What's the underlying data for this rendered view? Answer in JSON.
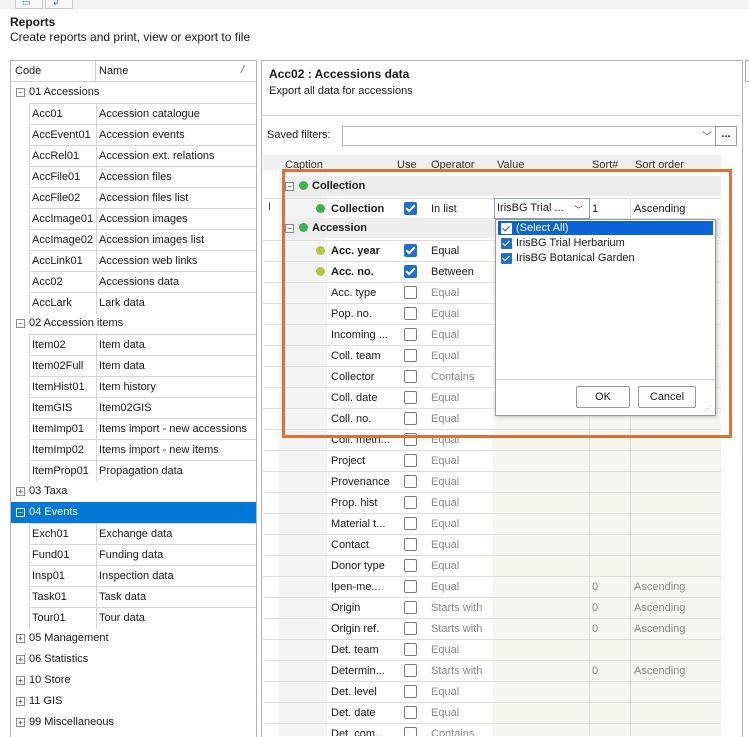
{
  "header": {
    "title": "Reports",
    "subtitle": "Create reports and print, view or export to file"
  },
  "left_panel": {
    "columns": {
      "code": "Code",
      "name": "Name",
      "sort_glyph": "/"
    },
    "groups": [
      {
        "label": "01 Accessions",
        "expanded": true,
        "selected": false,
        "items": [
          {
            "code": "Acc01",
            "name": "Accession catalogue"
          },
          {
            "code": "AccEvent01",
            "name": "Accession events"
          },
          {
            "code": "AccRel01",
            "name": "Accession ext. relations"
          },
          {
            "code": "AccFile01",
            "name": "Accession files"
          },
          {
            "code": "AccFile02",
            "name": "Accession files list"
          },
          {
            "code": "AccImage01",
            "name": "Accession images"
          },
          {
            "code": "AccImage02",
            "name": "Accession images list"
          },
          {
            "code": "AccLink01",
            "name": "Accession web links"
          },
          {
            "code": "Acc02",
            "name": "Accessions data"
          },
          {
            "code": "AccLark",
            "name": "Lark data"
          }
        ]
      },
      {
        "label": "02 Accession items",
        "expanded": true,
        "selected": false,
        "items": [
          {
            "code": "Item02",
            "name": "Item data"
          },
          {
            "code": "Item02Full",
            "name": "Item data"
          },
          {
            "code": "ItemHist01",
            "name": "Item history"
          },
          {
            "code": "ItemGIS",
            "name": "Item02GIS"
          },
          {
            "code": "ItemImp01",
            "name": "Items import - new accessions"
          },
          {
            "code": "ItemImp02",
            "name": "Items import - new items"
          },
          {
            "code": "ItemProp01",
            "name": "Propagation data"
          }
        ]
      },
      {
        "label": "03 Taxa",
        "expanded": false,
        "selected": false,
        "items": []
      },
      {
        "label": "04 Events",
        "expanded": true,
        "selected": true,
        "items": [
          {
            "code": "Exch01",
            "name": "Exchange data"
          },
          {
            "code": "Fund01",
            "name": "Funding data"
          },
          {
            "code": "Insp01",
            "name": "Inspection data"
          },
          {
            "code": "Task01",
            "name": "Task data"
          },
          {
            "code": "Tour01",
            "name": "Tour data"
          }
        ]
      },
      {
        "label": "05 Management",
        "expanded": false,
        "selected": false,
        "items": []
      },
      {
        "label": "06 Statistics",
        "expanded": false,
        "selected": false,
        "items": []
      },
      {
        "label": "10 Store",
        "expanded": false,
        "selected": false,
        "items": []
      },
      {
        "label": "11 GIS",
        "expanded": false,
        "selected": false,
        "items": []
      },
      {
        "label": "99 Miscellaneous",
        "expanded": false,
        "selected": false,
        "items": []
      }
    ]
  },
  "report": {
    "title": "Acc02 : Accessions data",
    "description": "Export all data for accessions"
  },
  "filters": {
    "label": "Saved filters:",
    "value": "",
    "more_label": "..."
  },
  "grid": {
    "headers": {
      "caption": "Caption",
      "use": "Use",
      "operator": "Operator",
      "value": "Value",
      "sort_num": "Sort#",
      "sort_order": "Sort order"
    },
    "sections": [
      {
        "label": "Collection",
        "rows": [
          {
            "caption": "Collection",
            "bold": true,
            "dot": "g",
            "use": true,
            "operator": "In list",
            "value": "IrisBG Trial ...",
            "sort_num": "1",
            "sort_order": "Ascending",
            "combo": true
          }
        ]
      },
      {
        "label": "Accession",
        "rows": [
          {
            "caption": "Acc. year",
            "bold": true,
            "dot": "y",
            "use": true,
            "operator": "Equal"
          },
          {
            "caption": "Acc. no.",
            "bold": true,
            "dot": "y",
            "use": true,
            "operator": "Between"
          },
          {
            "caption": "Acc. type",
            "use": false,
            "operator": "Equal"
          },
          {
            "caption": "Pop. no.",
            "use": false,
            "operator": "Equal"
          },
          {
            "caption": "Incoming ...",
            "use": false,
            "operator": "Equal"
          },
          {
            "caption": "Coll. team",
            "use": false,
            "operator": "Equal"
          },
          {
            "caption": "Collector",
            "use": false,
            "operator": "Contains"
          },
          {
            "caption": "Coll. date",
            "use": false,
            "operator": "Equal"
          },
          {
            "caption": "Coll. no.",
            "use": false,
            "operator": "Equal"
          },
          {
            "caption": "Coll. meth...",
            "use": false,
            "operator": "Equal"
          },
          {
            "caption": "Project",
            "use": false,
            "operator": "Equal"
          },
          {
            "caption": "Provenance",
            "use": false,
            "operator": "Equal"
          },
          {
            "caption": "Prop. hist",
            "use": false,
            "operator": "Equal"
          },
          {
            "caption": "Material t...",
            "use": false,
            "operator": "Equal"
          },
          {
            "caption": "Contact",
            "use": false,
            "operator": "Equal"
          },
          {
            "caption": "Donor type",
            "use": false,
            "operator": "Equal"
          },
          {
            "caption": "Ipen-me...",
            "use": false,
            "operator": "Equal",
            "sort_num": "0",
            "sort_order": "Ascending"
          },
          {
            "caption": "Origin",
            "use": false,
            "operator": "Starts with",
            "sort_num": "0",
            "sort_order": "Ascending"
          },
          {
            "caption": "Origin ref.",
            "use": false,
            "operator": "Starts with",
            "sort_num": "0",
            "sort_order": "Ascending"
          },
          {
            "caption": "Det. team",
            "use": false,
            "operator": "Equal"
          },
          {
            "caption": "Determin...",
            "use": false,
            "operator": "Starts with",
            "sort_num": "0",
            "sort_order": "Ascending"
          },
          {
            "caption": "Det. level",
            "use": false,
            "operator": "Equal"
          },
          {
            "caption": "Det. date",
            "use": false,
            "operator": "Equal"
          },
          {
            "caption": "Det. com...",
            "use": false,
            "operator": "Contains"
          }
        ]
      }
    ]
  },
  "dropdown": {
    "options": [
      {
        "label": "(Select All)",
        "checked": true,
        "selected": true
      },
      {
        "label": "IrisBG Trial Herbarium",
        "checked": true,
        "selected": false
      },
      {
        "label": "IrisBG Botanical Garden",
        "checked": true,
        "selected": false
      }
    ],
    "ok_label": "OK",
    "cancel_label": "Cancel"
  },
  "colors": {
    "selection": "#0078d7",
    "highlight_border": "#d9733a",
    "dot_green": "#3fb24f",
    "dot_yellow": "#b8c43a"
  }
}
